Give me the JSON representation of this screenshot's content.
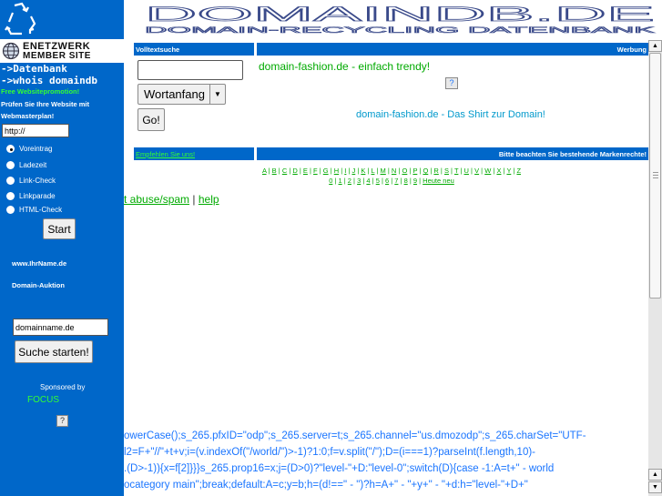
{
  "colors": {
    "sidebar_bg": "#0067c9",
    "accent_green": "#33ff33",
    "link_blue": "#0099cc",
    "code_blue": "#1a75ff"
  },
  "banner": {
    "title": "DOMAINDB.DE",
    "subtitle": "DOMAIN-RECYCLING DATENBANK"
  },
  "sidebar": {
    "netzwerk_line1": "eNetzwerk",
    "netzwerk_line2": "Member Site",
    "link_datenbank": "->Datenbank",
    "link_whois": "->whois domaindb",
    "promo": "Free Websitepromotion!",
    "check_text_1": "Prüfen Sie Ihre Website mit",
    "check_text_2": "Webmasterplan!",
    "url_value": "http://",
    "options": [
      {
        "label": "Voreintrag",
        "checked": true
      },
      {
        "label": "Ladezeit",
        "checked": false
      },
      {
        "label": "Link-Check",
        "checked": false
      },
      {
        "label": "Linkparade",
        "checked": false
      },
      {
        "label": "HTML-Check",
        "checked": false
      }
    ],
    "start_button": "Start",
    "ihrname": "www.IhrName.de",
    "auktion": "Domain-Auktion",
    "domain_value": "domainname.de",
    "search_button": "Suche starten!",
    "sponsored_by": "Sponsored by",
    "sponsor": "FOCUS",
    "broken_image": "?"
  },
  "main": {
    "volltext_header": "Volltextsuche",
    "werbung_header": "Werbung",
    "search_value": "",
    "select_value": "Wortanfang",
    "go_button": "Go!",
    "ad_title": "domain-fashion.de - einfach trendy!",
    "ad_icon": "?",
    "ad_text": "domain-fashion.de - Das Shirt zur Domain!",
    "recommend": "Empfehlen Sie uns!",
    "trademark": "Bitte beachten Sie bestehende Markenrechte!",
    "letters": [
      "A",
      "B",
      "C",
      "D",
      "E",
      "F",
      "G",
      "H",
      "I",
      "J",
      "K",
      "L",
      "M",
      "N",
      "O",
      "P",
      "Q",
      "R",
      "S",
      "T",
      "U",
      "V",
      "W",
      "X",
      "Y",
      "Z"
    ],
    "digits": [
      "0",
      "1",
      "2",
      "3",
      "4",
      "5",
      "6",
      "7",
      "8",
      "9"
    ],
    "heute_neu": "Heute neu",
    "abuse_link": "t abuse/spam",
    "separator": "|",
    "help_link": "help"
  },
  "code_lines": [
    "owerCase();s_265.pfxID=\"odp\";s_265.server=t;s_265.channel=\"us.dmozodp\";s_265.charSet=\"UTF-",
    "l2=F+\"//\"+t+v;i=(v.indexOf(\"/world/\")>-1)?1:0;f=v.split(\"/\");D=(i===1)?parseInt(f.length,10)-",
    ".(D>-1)){x=f[2]}}}s_265.prop16=x;j=(D>0)?\"level-\"+D:\"level-0\";switch(D){case -1:A=t+\" - world",
    "ocategory main\";break;default:A=c;y=b;h=(d!==\" - \")?h=A+\" - \"+y+\" - \"+d:h=\"level-\"+D+\""
  ]
}
